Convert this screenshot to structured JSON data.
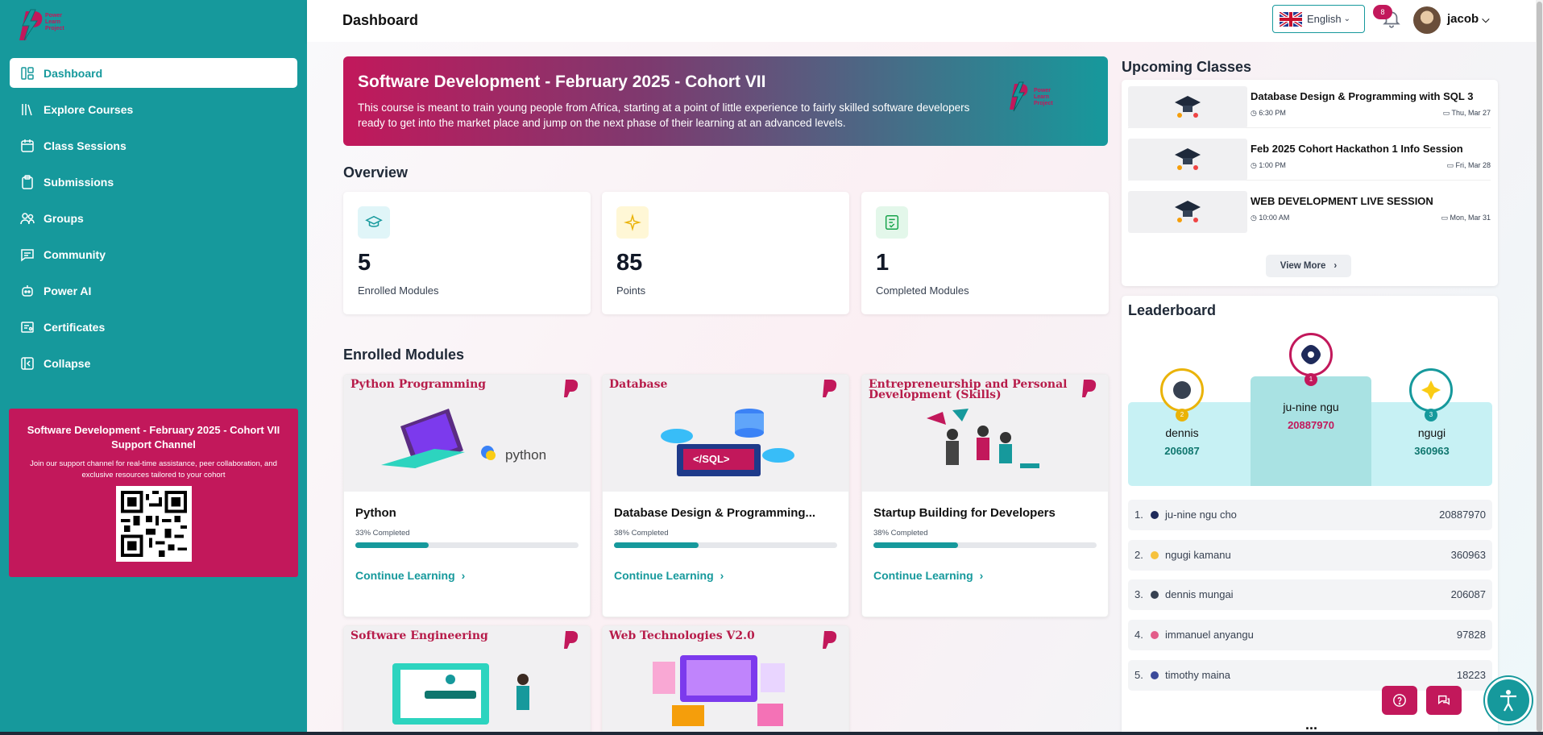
{
  "header": {
    "title": "Dashboard",
    "language": "English",
    "notifications": "8",
    "username": "jacob"
  },
  "sidebar": {
    "logo_text": "Power Learn Project",
    "items": [
      {
        "label": "Dashboard",
        "icon": "dashboard-icon",
        "active": true
      },
      {
        "label": "Explore Courses",
        "icon": "library-icon"
      },
      {
        "label": "Class Sessions",
        "icon": "calendar-icon"
      },
      {
        "label": "Submissions",
        "icon": "clipboard-icon"
      },
      {
        "label": "Groups",
        "icon": "users-icon"
      },
      {
        "label": "Community",
        "icon": "chat-icon"
      },
      {
        "label": "Power AI",
        "icon": "robot-icon"
      },
      {
        "label": "Certificates",
        "icon": "certificate-icon"
      },
      {
        "label": "Collapse",
        "icon": "collapse-icon"
      }
    ],
    "support": {
      "title": "Software Development - February 2025 - Cohort VII Support Channel",
      "text": "Join our support channel for real-time assistance, peer collaboration, and exclusive resources tailored to your cohort"
    }
  },
  "hero": {
    "title": "Software Development - February 2025 - Cohort VII",
    "description": "This course is meant to train young people from Africa, starting at a point of little experience to fairly skilled software developers ready to get into the market place and jump on the next phase of their learning at an advanced levels."
  },
  "overview": {
    "title": "Overview",
    "stats": [
      {
        "value": "5",
        "label": "Enrolled Modules",
        "icon": "graduation-cap-icon",
        "color": "#e0f5f8"
      },
      {
        "value": "85",
        "label": "Points",
        "icon": "sparkle-icon",
        "color": "#fff7d6"
      },
      {
        "value": "1",
        "label": "Completed Modules",
        "icon": "checklist-icon",
        "color": "#e3f7ea"
      }
    ]
  },
  "modules": {
    "title": "Enrolled Modules",
    "continue_label": "Continue Learning",
    "items": [
      {
        "image_title": "Python Programming",
        "image_sub": "python",
        "title": "Python",
        "progress_label": "33% Completed",
        "progress": 0.33
      },
      {
        "image_title": "Database",
        "image_sub": "</SQL>",
        "title": "Database Design & Programming...",
        "progress_label": "38% Completed",
        "progress": 0.38
      },
      {
        "image_title": "Entrepreneurship and Personal Development (Skills)",
        "title": "Startup Building for Developers",
        "progress_label": "38% Completed",
        "progress": 0.38
      },
      {
        "image_title": "Software Engineering"
      },
      {
        "image_title": "Web Technologies V2.0"
      }
    ]
  },
  "upcoming": {
    "title": "Upcoming Classes",
    "view_more": "View More",
    "items": [
      {
        "title": "Database Design & Programming with SQL 3",
        "time": "6:30 PM",
        "date": "Thu, Mar 27"
      },
      {
        "title": "Feb 2025 Cohort Hackathon 1 Info Session",
        "time": "1:00 PM",
        "date": "Fri, Mar 28"
      },
      {
        "title": "WEB DEVELOPMENT LIVE SESSION",
        "time": "10:00 AM",
        "date": "Mon, Mar 31"
      }
    ]
  },
  "leaderboard": {
    "title": "Leaderboard",
    "podium": [
      {
        "rank": "1",
        "name": "ju-nine ngu",
        "score": "20887970"
      },
      {
        "rank": "2",
        "name": "dennis",
        "score": "206087"
      },
      {
        "rank": "3",
        "name": "ngugi",
        "score": "360963"
      }
    ],
    "rows": [
      {
        "rank": "1.",
        "name": "ju-nine ngu cho",
        "score": "20887970",
        "color": "#1e2a5a"
      },
      {
        "rank": "2.",
        "name": "ngugi kamanu",
        "score": "360963",
        "color": "#f6c23e"
      },
      {
        "rank": "3.",
        "name": "dennis mungai",
        "score": "206087",
        "color": "#374151"
      },
      {
        "rank": "4.",
        "name": "immanuel anyangu",
        "score": "97828",
        "color": "#e35d8a"
      },
      {
        "rank": "5.",
        "name": "timothy maina",
        "score": "18223",
        "color": "#3b4a9a"
      }
    ],
    "more": "..."
  },
  "colors": {
    "primary": "#16999c",
    "accent": "#c2185b"
  }
}
